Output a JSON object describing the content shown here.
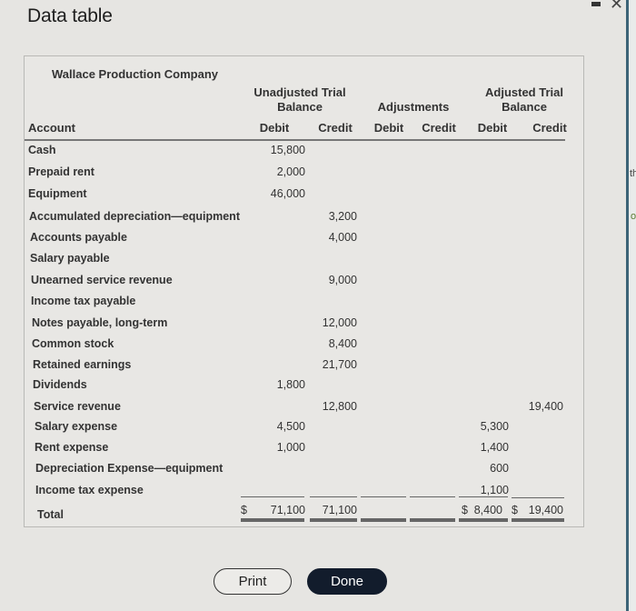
{
  "window": {
    "title": "Data table",
    "minimize_icon": "minimize-icon",
    "close_icon": "close-icon"
  },
  "table": {
    "company": "Wallace Production Company",
    "groups": {
      "unadjusted_line1": "Unadjusted Trial",
      "unadjusted_line2": "Balance",
      "adjustments": "Adjustments",
      "adjusted_line1": "Adjusted Trial",
      "adjusted_line2": "Balance"
    },
    "columns": {
      "account": "Account",
      "ut_debit": "Debit",
      "ut_credit": "Credit",
      "adj_debit": "Debit",
      "adj_credit": "Credit",
      "at_debit": "Debit",
      "at_credit": "Credit"
    },
    "rows": [
      {
        "account": "Cash",
        "ut_debit": "15,800",
        "ut_credit": "",
        "adj_debit": "",
        "adj_credit": "",
        "at_debit": "",
        "at_credit": ""
      },
      {
        "account": "Prepaid rent",
        "ut_debit": "2,000",
        "ut_credit": "",
        "adj_debit": "",
        "adj_credit": "",
        "at_debit": "",
        "at_credit": ""
      },
      {
        "account": "Equipment",
        "ut_debit": "46,000",
        "ut_credit": "",
        "adj_debit": "",
        "adj_credit": "",
        "at_debit": "",
        "at_credit": ""
      },
      {
        "account": "Accumulated depreciation—equipment",
        "ut_debit": "",
        "ut_credit": "3,200",
        "adj_debit": "",
        "adj_credit": "",
        "at_debit": "",
        "at_credit": ""
      },
      {
        "account": "Accounts payable",
        "ut_debit": "",
        "ut_credit": "4,000",
        "adj_debit": "",
        "adj_credit": "",
        "at_debit": "",
        "at_credit": ""
      },
      {
        "account": "Salary payable",
        "ut_debit": "",
        "ut_credit": "",
        "adj_debit": "",
        "adj_credit": "",
        "at_debit": "",
        "at_credit": ""
      },
      {
        "account": "Unearned service revenue",
        "ut_debit": "",
        "ut_credit": "9,000",
        "adj_debit": "",
        "adj_credit": "",
        "at_debit": "",
        "at_credit": ""
      },
      {
        "account": "Income tax payable",
        "ut_debit": "",
        "ut_credit": "",
        "adj_debit": "",
        "adj_credit": "",
        "at_debit": "",
        "at_credit": ""
      },
      {
        "account": "Notes payable, long-term",
        "ut_debit": "",
        "ut_credit": "12,000",
        "adj_debit": "",
        "adj_credit": "",
        "at_debit": "",
        "at_credit": ""
      },
      {
        "account": "Common stock",
        "ut_debit": "",
        "ut_credit": "8,400",
        "adj_debit": "",
        "adj_credit": "",
        "at_debit": "",
        "at_credit": ""
      },
      {
        "account": "Retained earnings",
        "ut_debit": "",
        "ut_credit": "21,700",
        "adj_debit": "",
        "adj_credit": "",
        "at_debit": "",
        "at_credit": ""
      },
      {
        "account": "Dividends",
        "ut_debit": "1,800",
        "ut_credit": "",
        "adj_debit": "",
        "adj_credit": "",
        "at_debit": "",
        "at_credit": ""
      },
      {
        "account": "Service revenue",
        "ut_debit": "",
        "ut_credit": "12,800",
        "adj_debit": "",
        "adj_credit": "",
        "at_debit": "",
        "at_credit": "19,400"
      },
      {
        "account": "Salary expense",
        "ut_debit": "4,500",
        "ut_credit": "",
        "adj_debit": "",
        "adj_credit": "",
        "at_debit": "5,300",
        "at_credit": ""
      },
      {
        "account": "Rent expense",
        "ut_debit": "1,000",
        "ut_credit": "",
        "adj_debit": "",
        "adj_credit": "",
        "at_debit": "1,400",
        "at_credit": ""
      },
      {
        "account": "Depreciation Expense—equipment",
        "ut_debit": "",
        "ut_credit": "",
        "adj_debit": "",
        "adj_credit": "",
        "at_debit": "600",
        "at_credit": ""
      },
      {
        "account": "Income tax expense",
        "ut_debit": "",
        "ut_credit": "",
        "adj_debit": "",
        "adj_credit": "",
        "at_debit": "1,100",
        "at_credit": ""
      }
    ],
    "total": {
      "label": "Total",
      "currency": "$",
      "ut_debit": "71,100",
      "ut_credit": "71,100",
      "adj_debit": "",
      "adj_credit": "",
      "at_debit": "8,400",
      "at_credit": "19,400"
    }
  },
  "buttons": {
    "print": "Print",
    "done": "Done"
  },
  "background_peek": {
    "text1": "th",
    "text2": "o"
  }
}
